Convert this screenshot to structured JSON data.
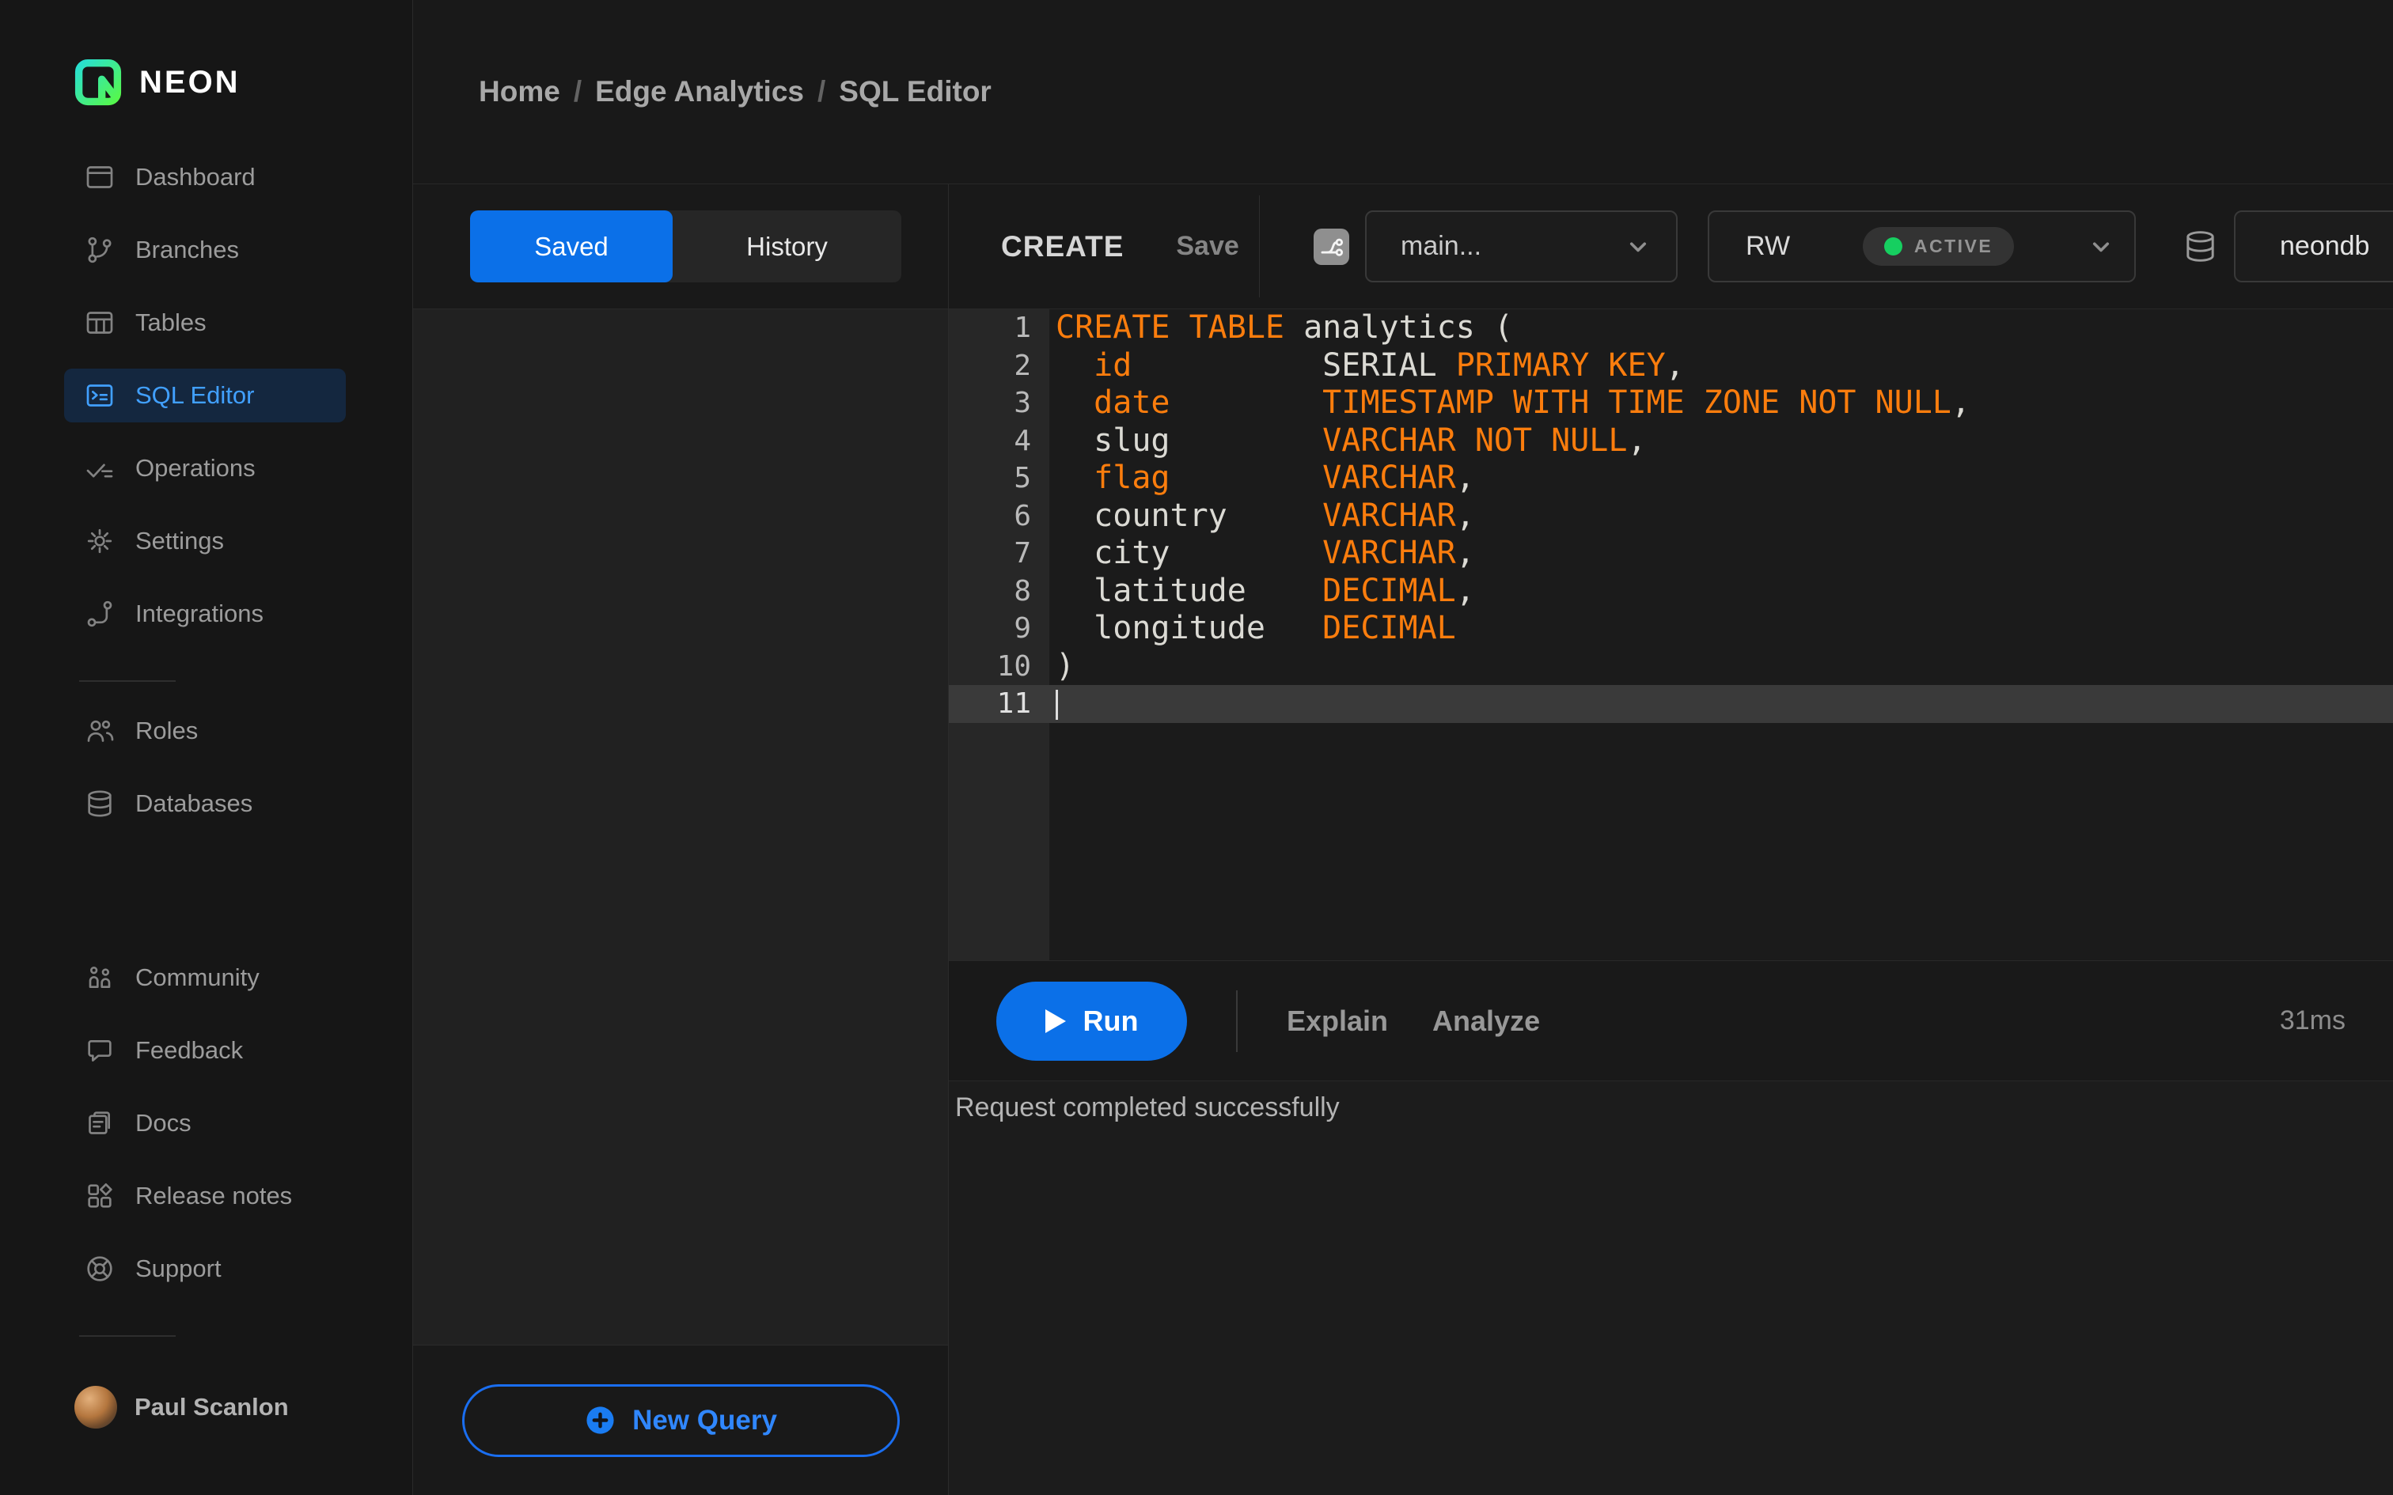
{
  "brand": {
    "name": "NEON"
  },
  "breadcrumb": {
    "items": [
      "Home",
      "Edge Analytics",
      "SQL Editor"
    ],
    "separator": "/"
  },
  "sidebar": {
    "main": [
      {
        "label": "Dashboard",
        "icon": "dashboard",
        "active": false
      },
      {
        "label": "Branches",
        "icon": "branches",
        "active": false
      },
      {
        "label": "Tables",
        "icon": "tables",
        "active": false
      },
      {
        "label": "SQL Editor",
        "icon": "sql-editor",
        "active": true
      },
      {
        "label": "Operations",
        "icon": "operations",
        "active": false
      },
      {
        "label": "Settings",
        "icon": "settings",
        "active": false
      },
      {
        "label": "Integrations",
        "icon": "integrations",
        "active": false
      }
    ],
    "secondary": [
      {
        "label": "Roles",
        "icon": "roles",
        "active": false
      },
      {
        "label": "Databases",
        "icon": "databases",
        "active": false
      }
    ],
    "bottom": [
      {
        "label": "Community",
        "icon": "community",
        "active": false
      },
      {
        "label": "Feedback",
        "icon": "feedback",
        "active": false
      },
      {
        "label": "Docs",
        "icon": "docs",
        "active": false
      },
      {
        "label": "Release notes",
        "icon": "release-notes",
        "active": false
      },
      {
        "label": "Support",
        "icon": "support",
        "active": false
      }
    ],
    "user": {
      "name": "Paul Scanlon"
    }
  },
  "queries_panel": {
    "tabs": [
      {
        "label": "Saved",
        "active": true
      },
      {
        "label": "History",
        "active": false
      }
    ],
    "new_query_label": "New Query"
  },
  "toolbar": {
    "title": "CREATE",
    "save_label": "Save",
    "branch_selector": {
      "value": "main..."
    },
    "compute_selector": {
      "value": "RW",
      "status": "ACTIVE"
    },
    "database_selector": {
      "value": "neondb"
    }
  },
  "editor": {
    "lines": [
      {
        "n": 1,
        "segments": [
          [
            "kw",
            "CREATE TABLE"
          ],
          [
            "pl",
            " analytics ("
          ]
        ]
      },
      {
        "n": 2,
        "segments": [
          [
            "pl",
            "  "
          ],
          [
            "kw",
            "id"
          ],
          [
            "pl",
            "          SERIAL "
          ],
          [
            "kw",
            "PRIMARY KEY"
          ],
          [
            "pl",
            ","
          ]
        ]
      },
      {
        "n": 3,
        "segments": [
          [
            "pl",
            "  "
          ],
          [
            "kw",
            "date"
          ],
          [
            "pl",
            "        "
          ],
          [
            "kw",
            "TIMESTAMP WITH TIME ZONE NOT NULL"
          ],
          [
            "pl",
            ","
          ]
        ]
      },
      {
        "n": 4,
        "segments": [
          [
            "pl",
            "  slug        "
          ],
          [
            "kw",
            "VARCHAR NOT NULL"
          ],
          [
            "pl",
            ","
          ]
        ]
      },
      {
        "n": 5,
        "segments": [
          [
            "pl",
            "  "
          ],
          [
            "kw",
            "flag"
          ],
          [
            "pl",
            "        "
          ],
          [
            "kw",
            "VARCHAR"
          ],
          [
            "pl",
            ","
          ]
        ]
      },
      {
        "n": 6,
        "segments": [
          [
            "pl",
            "  country     "
          ],
          [
            "kw",
            "VARCHAR"
          ],
          [
            "pl",
            ","
          ]
        ]
      },
      {
        "n": 7,
        "segments": [
          [
            "pl",
            "  city        "
          ],
          [
            "kw",
            "VARCHAR"
          ],
          [
            "pl",
            ","
          ]
        ]
      },
      {
        "n": 8,
        "segments": [
          [
            "pl",
            "  latitude    "
          ],
          [
            "kw",
            "DECIMAL"
          ],
          [
            "pl",
            ","
          ]
        ]
      },
      {
        "n": 9,
        "segments": [
          [
            "pl",
            "  longitude   "
          ],
          [
            "kw",
            "DECIMAL"
          ]
        ]
      },
      {
        "n": 10,
        "segments": [
          [
            "pl",
            ")"
          ]
        ]
      },
      {
        "n": 11,
        "segments": [],
        "active": true,
        "cursor": true
      }
    ]
  },
  "run_bar": {
    "run_label": "Run",
    "explain_label": "Explain",
    "analyze_label": "Analyze",
    "duration": "31ms"
  },
  "status_bar": {
    "message": "Request completed successfully"
  },
  "colors": {
    "accent_blue": "#0b70e8",
    "new_query_blue": "#3087ff",
    "code_keyword_orange": "#fb7d0d",
    "active_green": "#16cf60",
    "active_nav_blue": "#41a0ff"
  }
}
